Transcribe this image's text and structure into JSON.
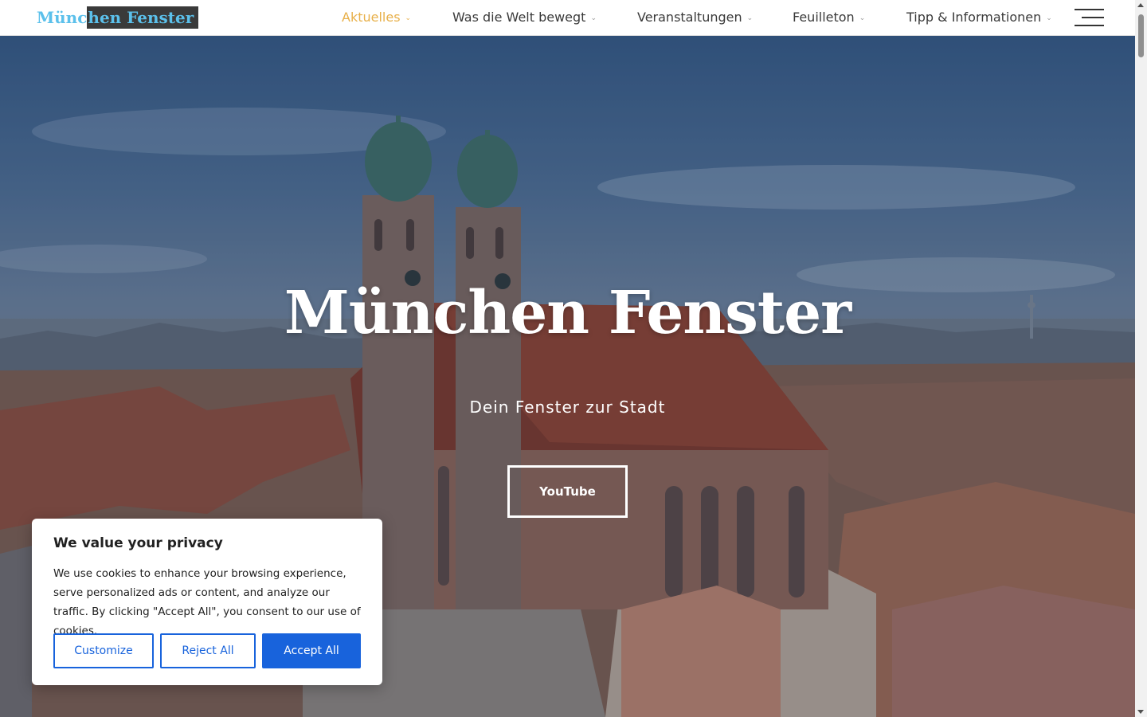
{
  "header": {
    "logo_part1": "Münc",
    "logo_part2": "hen Fenster",
    "nav": [
      {
        "label": "Aktuelles",
        "active": true
      },
      {
        "label": "Was die Welt bewegt",
        "active": false
      },
      {
        "label": "Veranstaltungen",
        "active": false
      },
      {
        "label": "Feuilleton",
        "active": false
      },
      {
        "label": "Tipp & Informationen",
        "active": false
      }
    ],
    "chevron": "⌄"
  },
  "hero": {
    "title": "München Fenster",
    "subtitle": "Dein Fenster zur Stadt",
    "button": "YouTube"
  },
  "cookie": {
    "title": "We value your privacy",
    "text": "We use cookies to enhance your browsing experience, serve personalized ads or content, and analyze our traffic. By clicking \"Accept All\", you consent to our use of cookies.",
    "customize": "Customize",
    "reject": "Reject All",
    "accept": "Accept All"
  },
  "colors": {
    "accent": "#e8b04a",
    "logo": "#5bc0eb",
    "cookie_button": "#1863dc"
  },
  "icons": {
    "menu": "hamburger-menu-icon",
    "chevron": "chevron-down-icon"
  }
}
